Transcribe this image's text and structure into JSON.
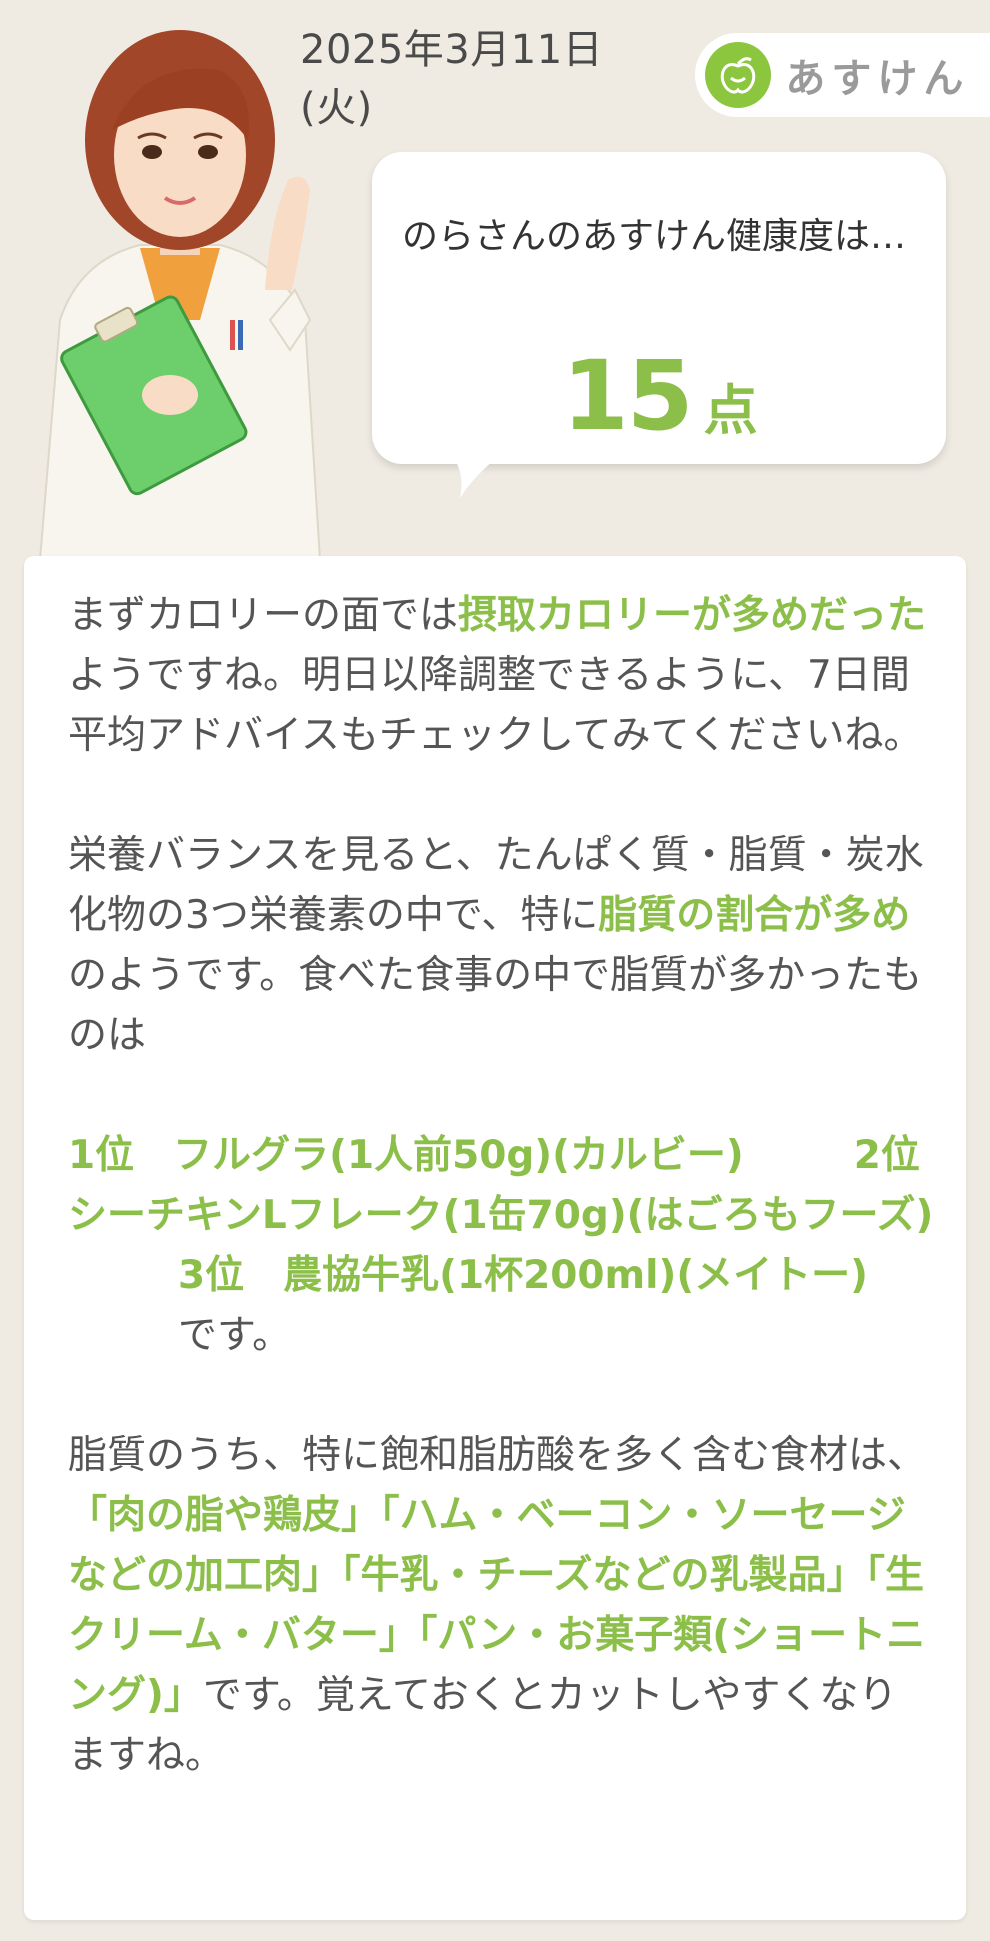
{
  "header": {
    "date": "2025年3月11日 (火)",
    "brand_name": "あすけん",
    "brand_color": "#8cc63f"
  },
  "bubble": {
    "text": "のらさんのあすけん健康度は…",
    "score": "15",
    "unit": "点",
    "score_color": "#8cbf4a"
  },
  "advice": {
    "p1": {
      "t1": "まずカロリーの面では",
      "h1": "摂取カロリーが多めだった",
      "t2": "ようですね。明日以降調整できるように、7日間平均アドバイスもチェックしてみてくださいね。"
    },
    "p2": {
      "t1": "栄養バランスを見ると、たんぱく質・脂質・炭水化物の3つ栄養素の中で、特に",
      "h1": "脂質の割合が多め",
      "t2": "のようです。食べた食事の中で脂質が多かったものは"
    },
    "p3": {
      "r1": "1位　フルグラ(1人前50g)(カルビー)",
      "r2": "2位　シーチキンLフレーク(1缶70g)(はごろもフーズ)",
      "r3": "3位　農協牛乳(1杯200ml)(メイトー)",
      "t1": "です。"
    },
    "p4": {
      "t1": "脂質のうち、特に飽和脂肪酸を多く含む食材は、",
      "h1": "「肉の脂や鶏皮」「ハム・ベーコン・ソーセージなどの加工肉」「牛乳・チーズなどの乳製品」「生クリーム・バター」「パン・お菓子類(ショートニング)」",
      "t2": "です。覚えておくとカットしやすくなりますね。"
    }
  }
}
